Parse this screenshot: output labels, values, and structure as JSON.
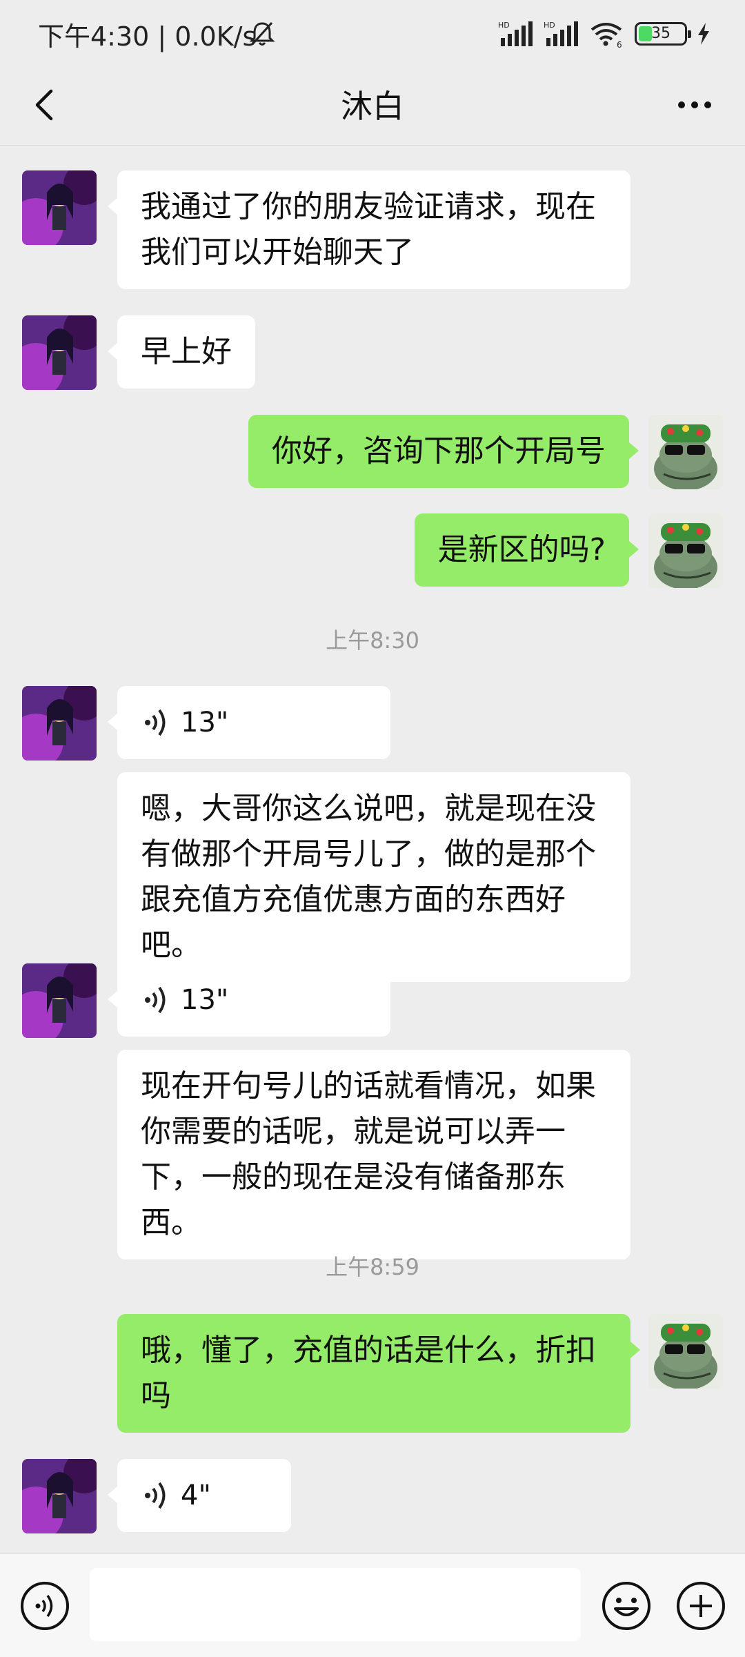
{
  "status": {
    "time_speed": "下午4:30 | 0.0K/s",
    "battery": "35",
    "battery_level_percent": 35
  },
  "header": {
    "title": "沐白"
  },
  "messages": [
    {
      "side": "left",
      "kind": "text",
      "text": "我通过了你的朋友验证请求，现在我们可以开始聊天了"
    },
    {
      "side": "left",
      "kind": "text",
      "text": "早上好"
    },
    {
      "side": "right",
      "kind": "text",
      "text": "你好，咨询下那个开局号"
    },
    {
      "side": "right",
      "kind": "text",
      "text": "是新区的吗?"
    },
    {
      "kind": "time",
      "text": "上午8:30"
    },
    {
      "side": "left",
      "kind": "voice",
      "text": "13\""
    },
    {
      "side": "left",
      "kind": "text",
      "text": "嗯，大哥你这么说吧，就是现在没有做那个开局号儿了，做的是那个跟充值方充值优惠方面的东西好吧。"
    },
    {
      "side": "left",
      "kind": "voice",
      "text": "13\""
    },
    {
      "side": "left",
      "kind": "text",
      "text": "现在开句号儿的话就看情况，如果你需要的话呢，就是说可以弄一下，一般的现在是没有储备那东西。"
    },
    {
      "kind": "time",
      "text": "上午8:59"
    },
    {
      "side": "right",
      "kind": "text",
      "text": "哦，懂了，充值的话是什么，折扣吗"
    },
    {
      "side": "left",
      "kind": "voice",
      "text": "4\""
    }
  ],
  "input": {
    "value": ""
  },
  "colors": {
    "background": "#ededed",
    "sent_bubble": "#95ec69",
    "received_bubble": "#ffffff"
  }
}
